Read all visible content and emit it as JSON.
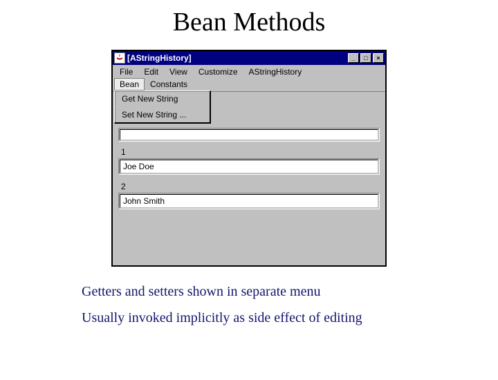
{
  "slide": {
    "title": "Bean Methods",
    "caption1": "Getters and setters shown in separate menu",
    "caption2": "Usually invoked implicitly as side effect of editing"
  },
  "window": {
    "title": "[AStringHistory]",
    "controls": {
      "min": "_",
      "max": "□",
      "close": "×"
    }
  },
  "menubar": {
    "row1": [
      "File",
      "Edit",
      "View",
      "Customize",
      "AStringHistory"
    ],
    "row2": [
      "Bean",
      "Constants"
    ],
    "selected": "Bean"
  },
  "dropdown": {
    "items": [
      "Get New String",
      "Set New String ..."
    ]
  },
  "fields": [
    {
      "label": "1",
      "value": "Joe Doe"
    },
    {
      "label": "2",
      "value": "John Smith"
    }
  ]
}
